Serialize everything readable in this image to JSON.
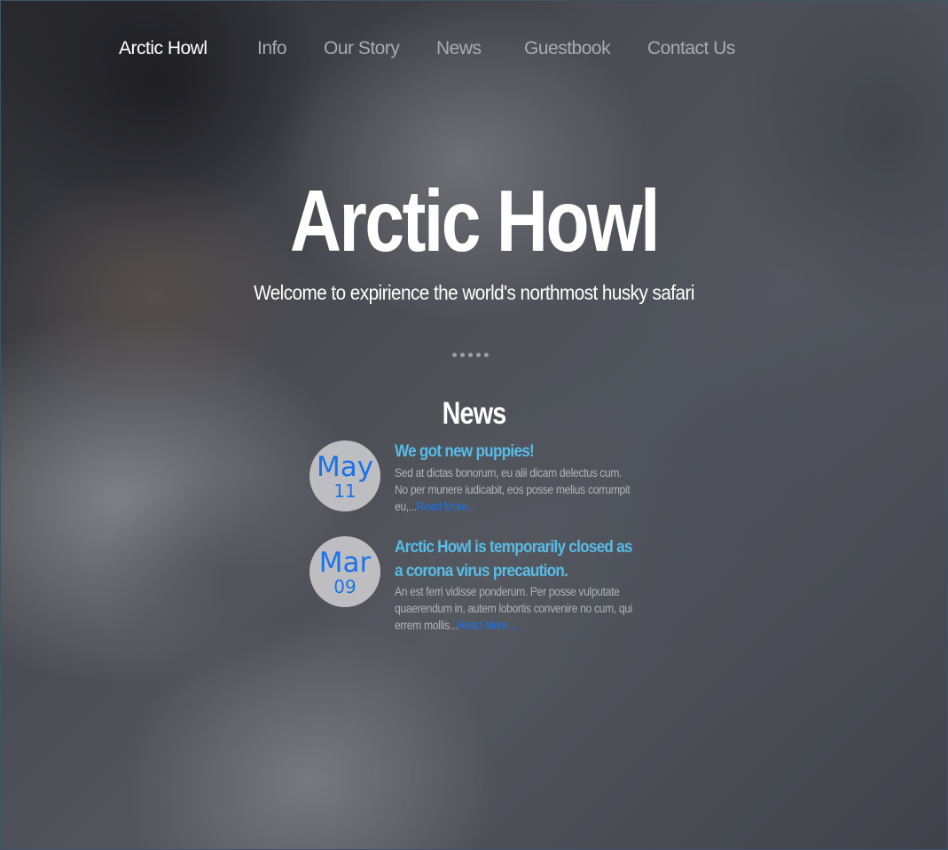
{
  "nav": {
    "brand": "Arctic Howl",
    "items": [
      "Info",
      "Our Story",
      "News",
      "Guestbook",
      "Contact Us"
    ]
  },
  "hero": {
    "title": "Arctic Howl",
    "subtitle": "Welcome to expirience the world's northmost husky safari"
  },
  "carousel": {
    "dot_count": 5
  },
  "news": {
    "title": "News",
    "items": [
      {
        "month": "May",
        "day": "11",
        "headline": "We got new puppies!",
        "text": "Sed at dictas bonorum, eu alii dicam delectus cum. No per munere iudicabit, eos posse melius corrumpit eu,...",
        "link": "Read More..."
      },
      {
        "month": "Mar",
        "day": "09",
        "headline": "Arctic Howl is temporarily closed as a corona virus precaution.",
        "text": "An est ferri vidisse ponderum. Per posse vulputate quaerendum in, autem lobortis convenire no cum, qui errem mollis...",
        "link": "Read More..."
      }
    ]
  },
  "colors": {
    "accent_blue": "#1a73e8",
    "headline_blue": "#57bde6",
    "nav_inactive": "#a9abb0"
  }
}
